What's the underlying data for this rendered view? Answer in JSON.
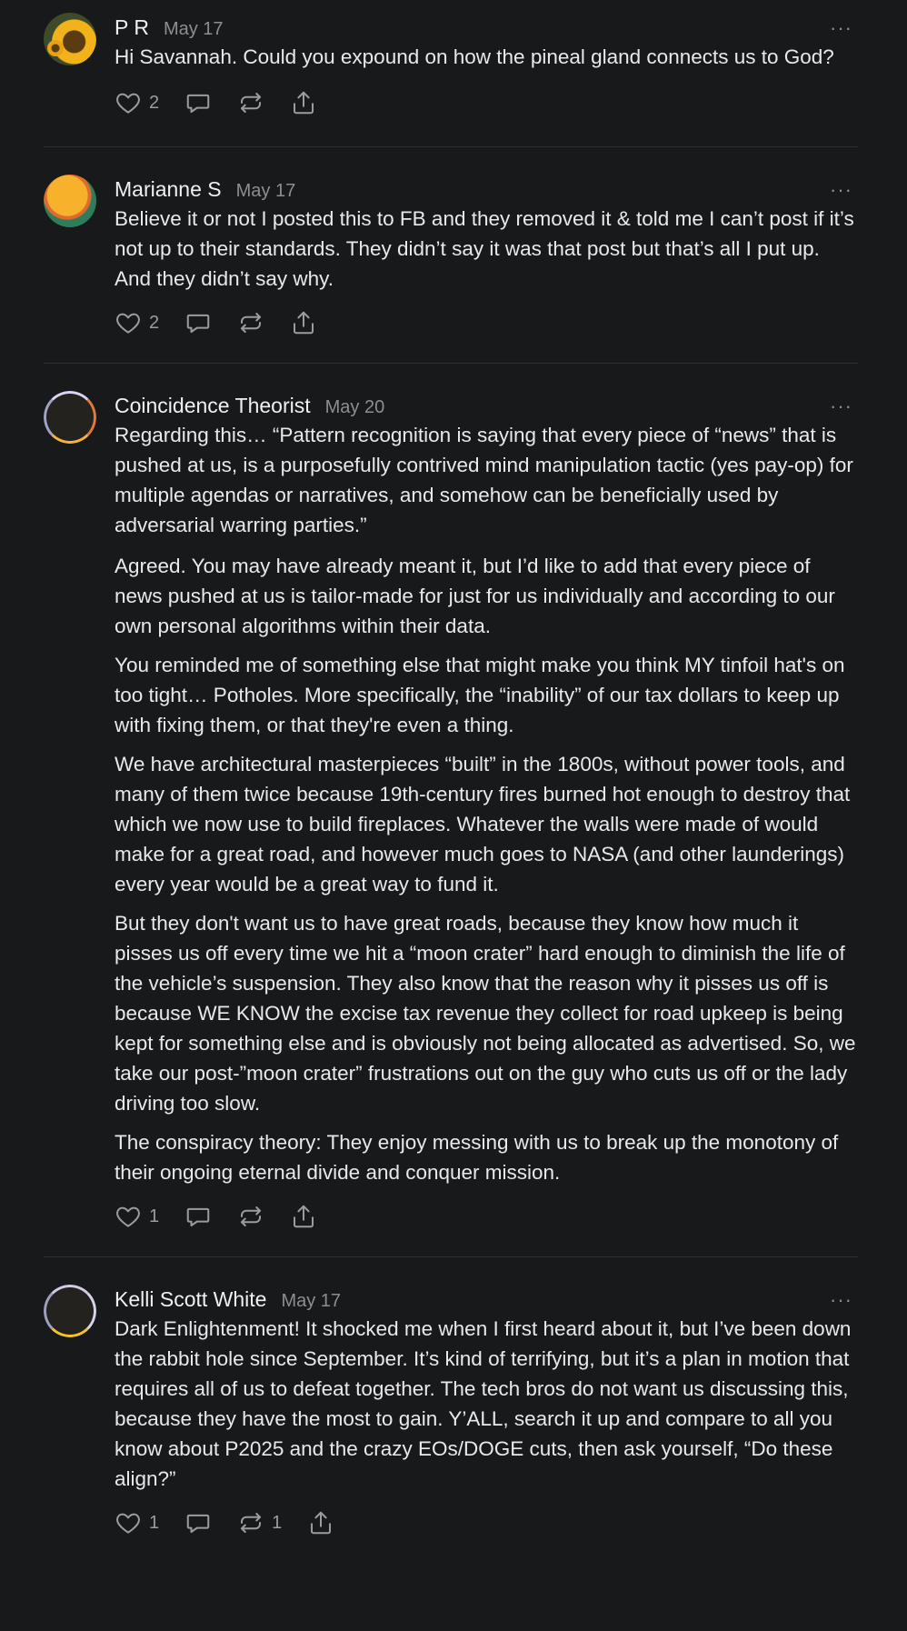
{
  "comments": [
    {
      "author": "P R",
      "date": "May 17",
      "paragraphs": [
        "Hi Savannah. Could you expound on how the pineal gland connects us to God?"
      ],
      "likes": "2",
      "restacks": ""
    },
    {
      "author": "Marianne S",
      "date": "May 17",
      "paragraphs": [
        "Believe it or not I posted this to FB and they removed it & told me I can’t post if it’s not up to their standards. They didn’t say it was that post but that’s all I put up. And they didn’t say why."
      ],
      "likes": "2",
      "restacks": ""
    },
    {
      "author": "Coincidence Theorist",
      "date": "May 20",
      "paragraphs": [
        "Regarding this… “Pattern recognition is saying that every piece of “news” that is pushed at us, is a purposefully contrived mind manipulation tactic (yes pay-op) for multiple agendas or narratives, and somehow can be beneficially used by adversarial warring parties.”",
        "Agreed. You may have already meant it, but I’d like to add that every piece of news pushed at us is tailor-made for just for us individually and according to our own personal algorithms within their data.",
        "You reminded me of something else that might make you think MY tinfoil hat's on too tight… Potholes. More specifically, the “inability” of our tax dollars to keep up with fixing them, or that they're even a thing.",
        "We have architectural masterpieces “built” in the 1800s, without power tools, and many of them twice because 19th-century fires burned hot enough to destroy that which we now use to build fireplaces. Whatever the walls were made of would make for a great road, and however much goes to NASA (and other launderings) every year would be a great way to fund it.",
        "But they don't want us to have great roads, because they know how much it pisses us off every time we hit a “moon crater” hard enough to diminish the life of the vehicle’s suspension. They also know that the reason why it pisses us off is because WE KNOW the excise tax revenue they collect for road upkeep is being kept for something else and is obviously not being allocated as advertised. So, we take our post-”moon crater” frustrations out on the guy who cuts us off or the lady driving too slow.",
        "The conspiracy theory: They enjoy messing with us to break up the monotony of their ongoing eternal divide and conquer mission."
      ],
      "likes": "1",
      "restacks": ""
    },
    {
      "author": "Kelli Scott White",
      "date": "May 17",
      "paragraphs": [
        "Dark Enlightenment! It shocked me when I first heard about it, but I’ve been down the rabbit hole since September. It’s kind of terrifying, but it’s a plan in motion that requires all of us to defeat together. The tech bros do not want us discussing this, because they have the most to gain. Y’ALL, search it up and compare to all you know about P2025 and the crazy EOs/DOGE cuts, then ask yourself, “Do these align?”"
      ],
      "likes": "1",
      "restacks": "1"
    }
  ],
  "icons": {
    "like": "heart-icon",
    "reply": "speech-bubble-icon",
    "restack": "refresh-icon",
    "share": "share-icon",
    "more": "ellipsis-icon"
  },
  "more_glyph": "···",
  "colors": {
    "background": "#18191b",
    "text": "#e9e9ea",
    "muted": "#8d8e93",
    "divider": "#2e2f32"
  }
}
